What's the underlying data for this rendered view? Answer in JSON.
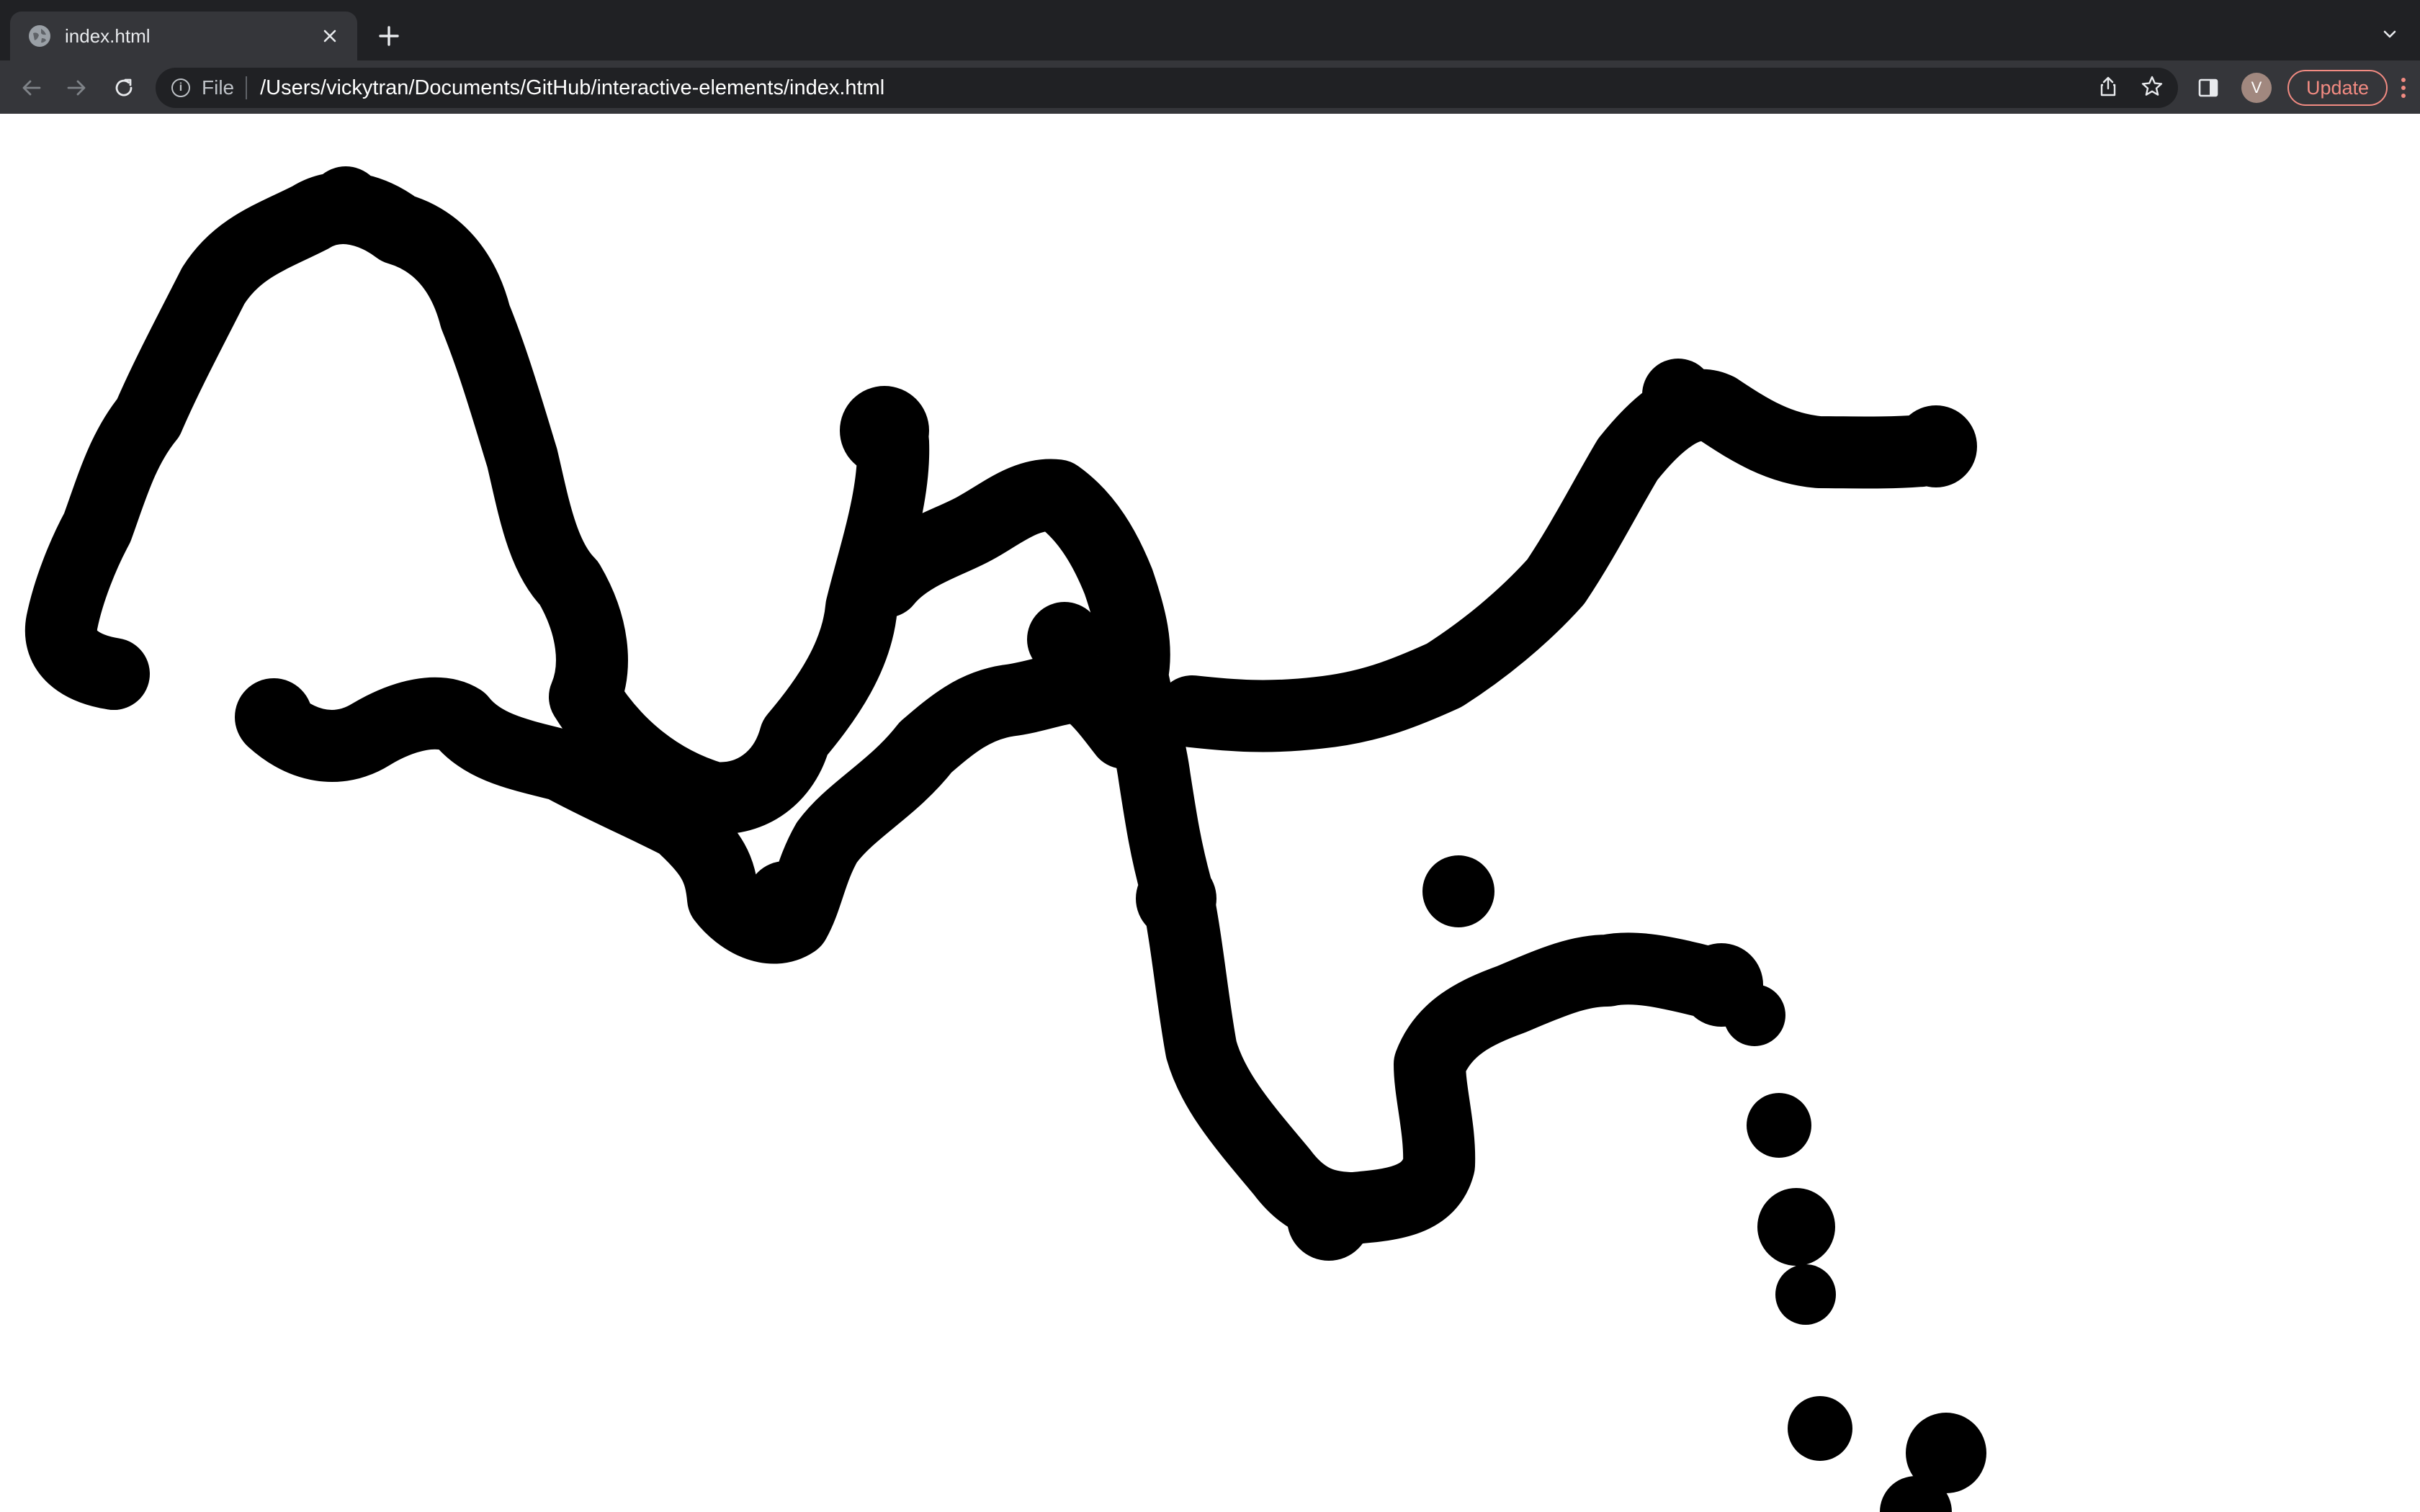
{
  "browser": {
    "tab": {
      "title": "index.html",
      "favicon": "globe-icon",
      "close_icon": "close-icon"
    },
    "new_tab_icon": "plus-icon",
    "tab_search_icon": "chevron-down-icon",
    "toolbar": {
      "back_icon": "arrow-left-icon",
      "forward_icon": "arrow-right-icon",
      "reload_icon": "reload-icon",
      "omnibox": {
        "info_icon": "info-icon",
        "scheme_label": "File",
        "url": "/Users/vickytran/Documents/GitHub/interactive-elements/index.html",
        "share_icon": "share-icon",
        "bookmark_icon": "star-icon"
      },
      "side_panel_icon": "side-panel-icon",
      "profile_initial": "V",
      "update_label": "Update",
      "menu_icon": "more-vert-icon"
    },
    "colors": {
      "tab_strip": "#202124",
      "toolbar": "#35363a",
      "omnibox": "#202124",
      "update_accent": "#f28b82",
      "avatar": "#a1887f"
    }
  },
  "page": {
    "canvas": {
      "background": "#ffffff",
      "brush_color": "#000000",
      "content": "freehand black brush strokes drawn with round dots"
    }
  }
}
